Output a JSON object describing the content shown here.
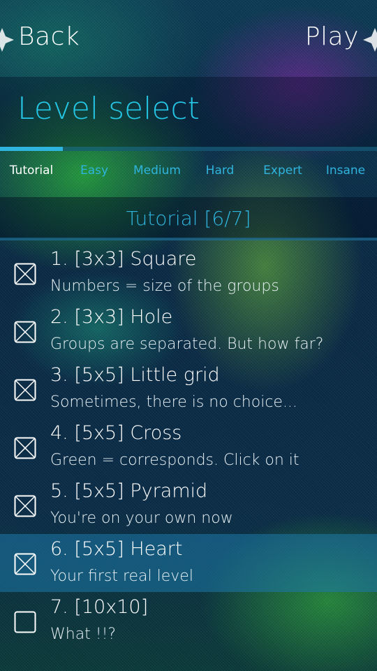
{
  "nav": {
    "back_label": "Back",
    "play_label": "Play"
  },
  "header": {
    "title": "Level select"
  },
  "tabs": [
    {
      "label": "Tutorial",
      "active": true
    },
    {
      "label": "Easy",
      "active": false
    },
    {
      "label": "Medium",
      "active": false
    },
    {
      "label": "Hard",
      "active": false
    },
    {
      "label": "Expert",
      "active": false
    },
    {
      "label": "Insane",
      "active": false
    }
  ],
  "section": {
    "title": "Tutorial [6/7]"
  },
  "levels": [
    {
      "title": "1. [3x3] Square",
      "subtitle": "Numbers = size of the groups",
      "completed": true
    },
    {
      "title": "2. [3x3] Hole",
      "subtitle": "Groups are separated. But how far?",
      "completed": true
    },
    {
      "title": "3. [5x5] Little grid",
      "subtitle": "Sometimes, there is no choice...",
      "completed": true
    },
    {
      "title": "4. [5x5] Cross",
      "subtitle": "Green = corresponds. Click on it",
      "completed": true
    },
    {
      "title": "5. [5x5] Pyramid",
      "subtitle": "You're on your own now",
      "completed": true
    },
    {
      "title": "6. [5x5] Heart",
      "subtitle": "Your first real level",
      "completed": true,
      "selected": true
    },
    {
      "title": "7. [10x10]",
      "subtitle": "What !!?",
      "completed": false
    }
  ],
  "colors": {
    "accent": "#2fb4dd",
    "title_accent": "#25c7e6",
    "selected_row": "#1e78aa"
  }
}
